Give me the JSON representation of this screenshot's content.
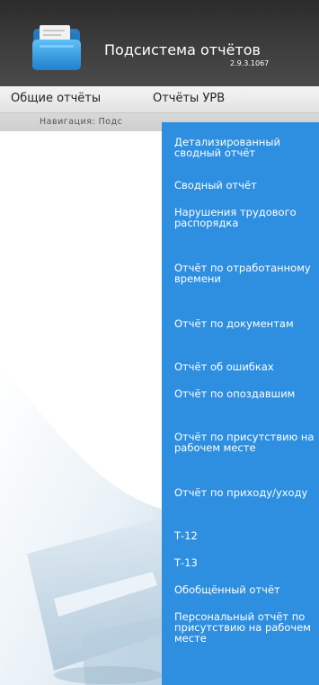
{
  "header": {
    "title": "Подсистема отчётов",
    "version": "2.9.3.1067"
  },
  "menu": {
    "items": [
      "Общие отчёты",
      "Отчёты УРВ"
    ]
  },
  "nav": {
    "text": "Навигация: Подс"
  },
  "dropdown": {
    "items": [
      "Детализированный сводный отчёт",
      "Сводный отчёт",
      "Нарушения трудового распорядка",
      "Отчёт по отработанному времени",
      "Отчёт по документам",
      "Отчёт об ошибках",
      "Отчёт по опоздавшим",
      "Отчёт по присутствию на рабочем месте",
      "Отчёт по приходу/уходу",
      "Т-12",
      "Т-13",
      "Обобщённый отчёт",
      "Персональный отчёт по присутствию на рабочем месте"
    ]
  },
  "colors": {
    "header_bg": "#333333",
    "menu_bg": "#e8e8e8",
    "dropdown_bg": "#2e8fe0",
    "logo_blue": "#3aa0e8"
  },
  "icons": {
    "logo": "folder-reports-icon"
  }
}
